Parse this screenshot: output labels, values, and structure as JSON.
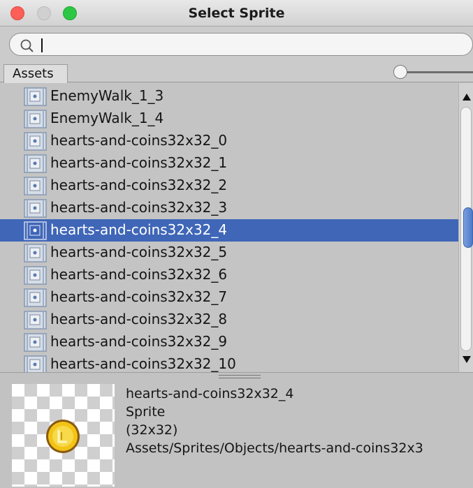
{
  "window": {
    "title": "Select Sprite"
  },
  "search": {
    "value": "",
    "placeholder": ""
  },
  "tabs": {
    "assets": "Assets"
  },
  "list": {
    "items": [
      {
        "label": "EnemyWalk_1_3",
        "selected": false
      },
      {
        "label": "EnemyWalk_1_4",
        "selected": false
      },
      {
        "label": "hearts-and-coins32x32_0",
        "selected": false
      },
      {
        "label": "hearts-and-coins32x32_1",
        "selected": false
      },
      {
        "label": "hearts-and-coins32x32_2",
        "selected": false
      },
      {
        "label": "hearts-and-coins32x32_3",
        "selected": false
      },
      {
        "label": "hearts-and-coins32x32_4",
        "selected": true
      },
      {
        "label": "hearts-and-coins32x32_5",
        "selected": false
      },
      {
        "label": "hearts-and-coins32x32_6",
        "selected": false
      },
      {
        "label": "hearts-and-coins32x32_7",
        "selected": false
      },
      {
        "label": "hearts-and-coins32x32_8",
        "selected": false
      },
      {
        "label": "hearts-and-coins32x32_9",
        "selected": false
      },
      {
        "label": "hearts-and-coins32x32_10",
        "selected": false
      }
    ]
  },
  "preview": {
    "name": "hearts-and-coins32x32_4",
    "type": "Sprite",
    "size": "(32x32)",
    "path": "Assets/Sprites/Objects/hearts-and-coins32x3"
  },
  "colors": {
    "selection": "#3f66b7",
    "close": "#fc5f58",
    "zoom": "#2dc744",
    "coin": "#f2c416"
  },
  "icons": {
    "search": "search-icon",
    "sprite": "sprite-icon",
    "coin": "coin-preview-icon"
  }
}
